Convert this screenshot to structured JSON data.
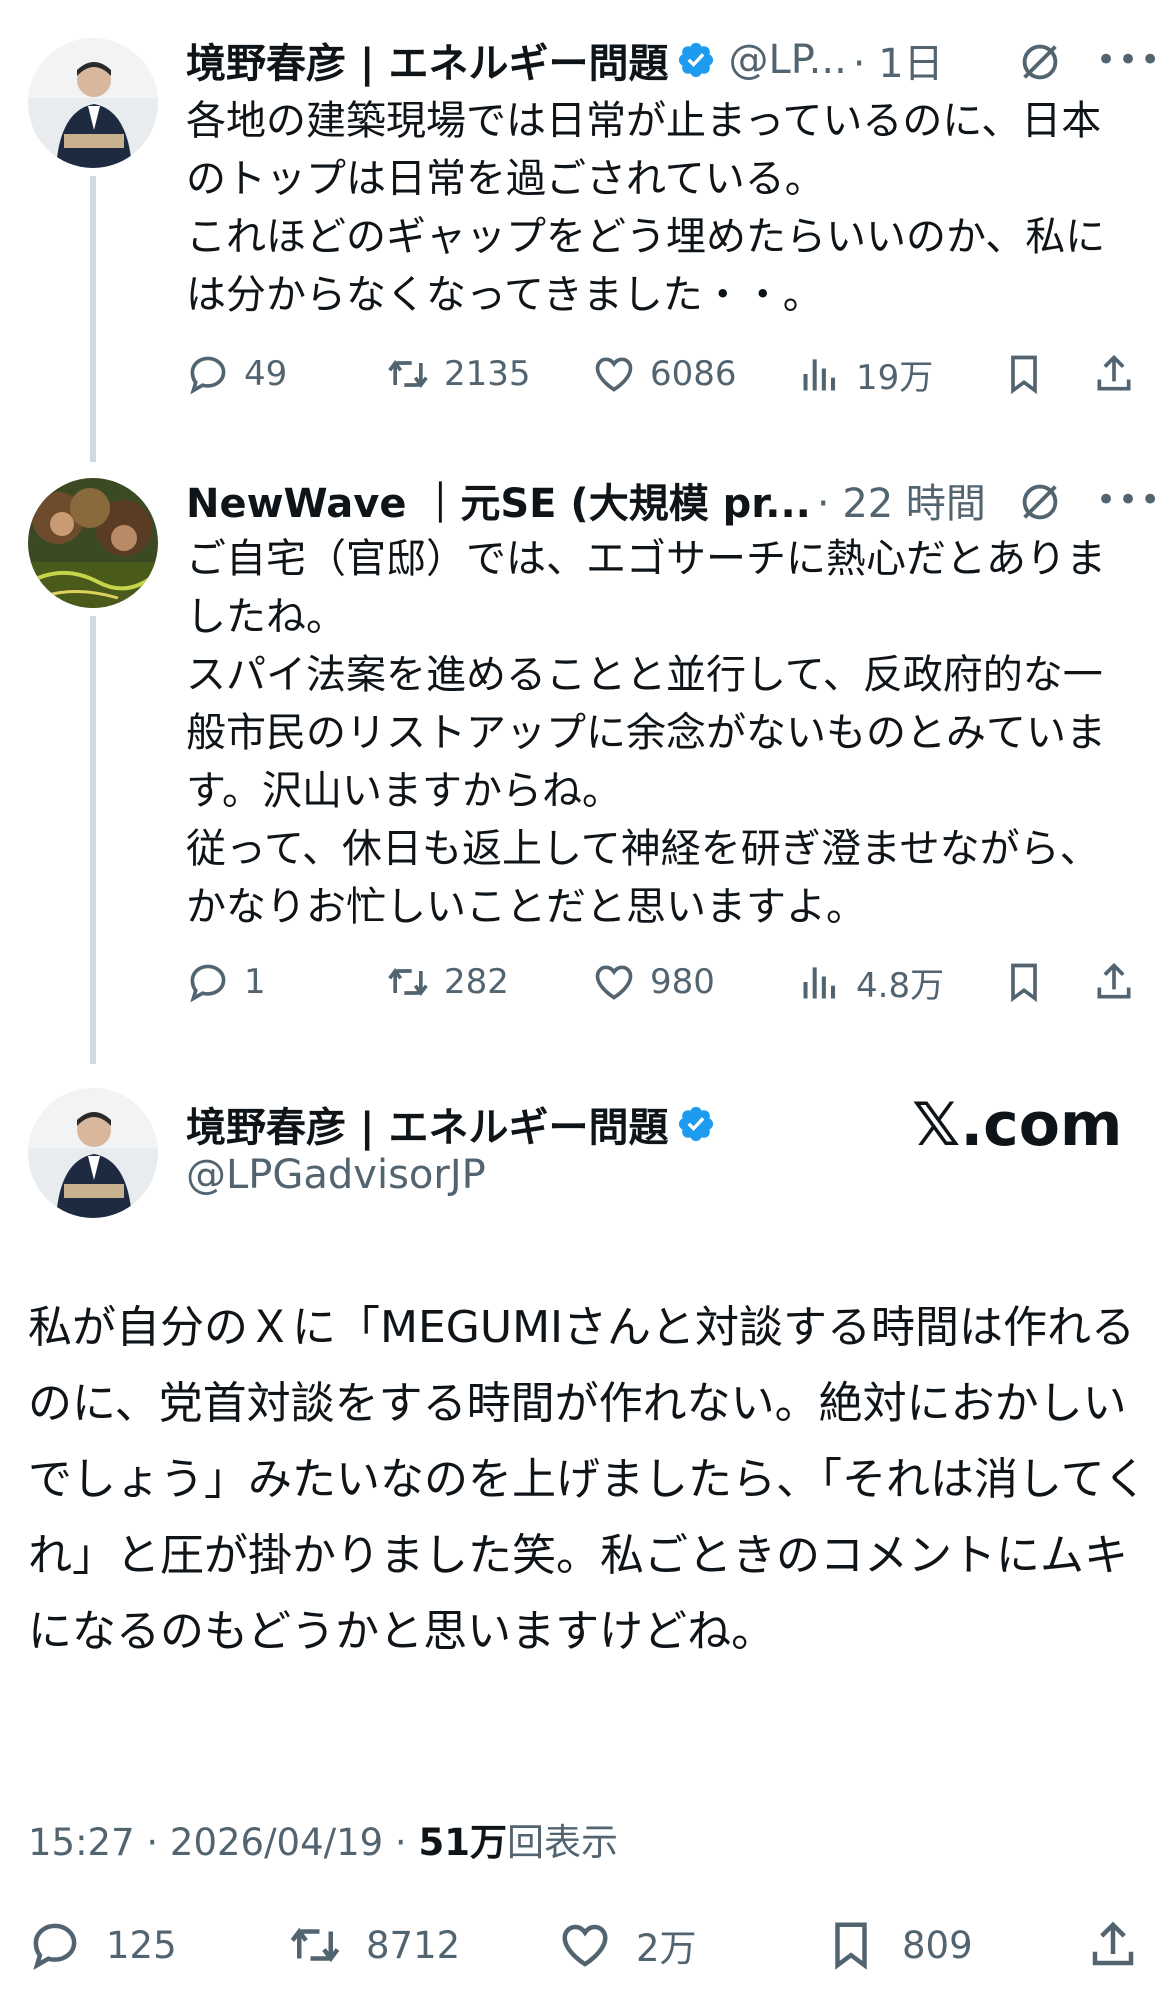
{
  "tweet1": {
    "display_name": "境野春彦 | エネルギー問題",
    "handle": "@LP...",
    "time": "· 1日",
    "text": "各地の建築現場では日常が止まっているのに、日本のトップは日常を過ごされている。\nこれほどのギャップをどう埋めたらいいのか、私には分からなくなってきました・・。",
    "replies": "49",
    "retweets": "2135",
    "likes": "6086",
    "views": "19万"
  },
  "tweet2": {
    "display_name": "NewWave ｜元SE (大規模 pr...",
    "time": "· 22 時間",
    "text": "ご自宅（官邸）では、エゴサーチに熱心だとありましたね。\nスパイ法案を進めることと並行して、反政府的な一般市民のリストアップに余念がないものとみています。沢山いますからね。\n従って、休日も返上して神経を研ぎ澄ませながら、かなりお忙しいことだと思いますよ。",
    "replies": "1",
    "retweets": "282",
    "likes": "980",
    "views": "4.8万"
  },
  "main_tweet": {
    "display_name": "境野春彦 | エネルギー問題",
    "handle": "@LPGadvisorJP",
    "watermark": "𝕏.com",
    "text": "私が自分のＸに「MEGUMIさんと対談する時間は作れるのに、党首対談をする時間が作れない。絶対におかしいでしょう」みたいなのを上げましたら、「それは消してくれ」と圧が掛かりました笑。私ごときのコメントにムキになるのもどうかと思いますけどね。",
    "time": "15:27 · 2026/04/19 · ",
    "views_count": "51万",
    "views_label": "回表示",
    "replies": "125",
    "retweets": "8712",
    "likes": "2万",
    "bookmarks": "809"
  },
  "icons": {
    "reply": "reply-icon",
    "retweet": "retweet-icon",
    "like": "heart-icon",
    "views": "views-icon",
    "bookmark": "bookmark-icon",
    "share": "share-icon",
    "grok": "grok-icon",
    "more": "more-icon",
    "verified": "verified-badge-icon"
  },
  "colors": {
    "verified": "#1d9bf0",
    "text": "#0f1419",
    "muted": "#536471",
    "thread_line": "#cfd9de"
  }
}
